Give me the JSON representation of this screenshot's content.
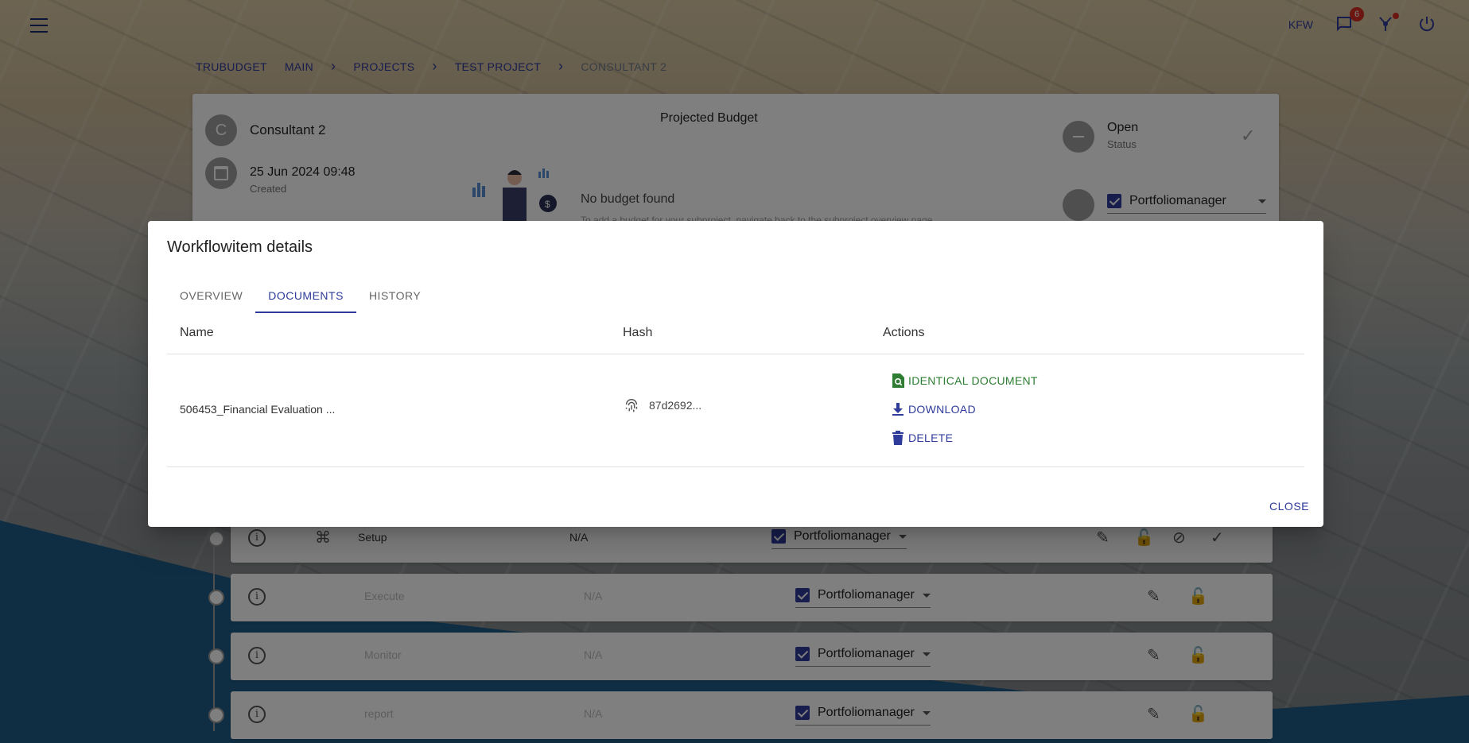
{
  "topbar": {
    "org": "KFW",
    "notification_count": "6"
  },
  "breadcrumb": [
    "TRUBUDGET",
    "MAIN",
    "PROJECTS",
    "TEST PROJECT",
    "CONSULTANT 2"
  ],
  "subproject": {
    "avatar_letter": "C",
    "name": "Consultant 2",
    "created_date": "25 Jun 2024 09:48",
    "created_label": "Created",
    "projected_budget_title": "Projected Budget",
    "no_budget": "No budget found",
    "no_budget_hint": "To add a budget for your subproject, navigate back to the subproject overview page.",
    "status": "Open",
    "status_label": "Status",
    "assignee": "Portfoliomanager"
  },
  "workflowitems": [
    {
      "name": "Setup",
      "amount": "N/A",
      "assignee": "Portfoliomanager"
    },
    {
      "name": "Execute",
      "amount": "N/A",
      "assignee": "Portfoliomanager"
    },
    {
      "name": "Monitor",
      "amount": "N/A",
      "assignee": "Portfoliomanager"
    },
    {
      "name": "report",
      "amount": "N/A",
      "assignee": "Portfoliomanager"
    }
  ],
  "dialog": {
    "title": "Workflowitem details",
    "tabs": [
      "OVERVIEW",
      "DOCUMENTS",
      "HISTORY"
    ],
    "active_tab": "DOCUMENTS",
    "columns": {
      "name": "Name",
      "hash": "Hash",
      "actions": "Actions"
    },
    "documents": [
      {
        "name": "506453_Financial Evaluation ...",
        "hash": "87d2692...",
        "actions": {
          "identical": "IDENTICAL DOCUMENT",
          "download": "DOWNLOAD",
          "delete": "DELETE"
        }
      }
    ],
    "close_label": "CLOSE"
  },
  "colors": {
    "primary": "#2e3b9a",
    "success": "#2e7d32",
    "badge": "#d62d20"
  }
}
